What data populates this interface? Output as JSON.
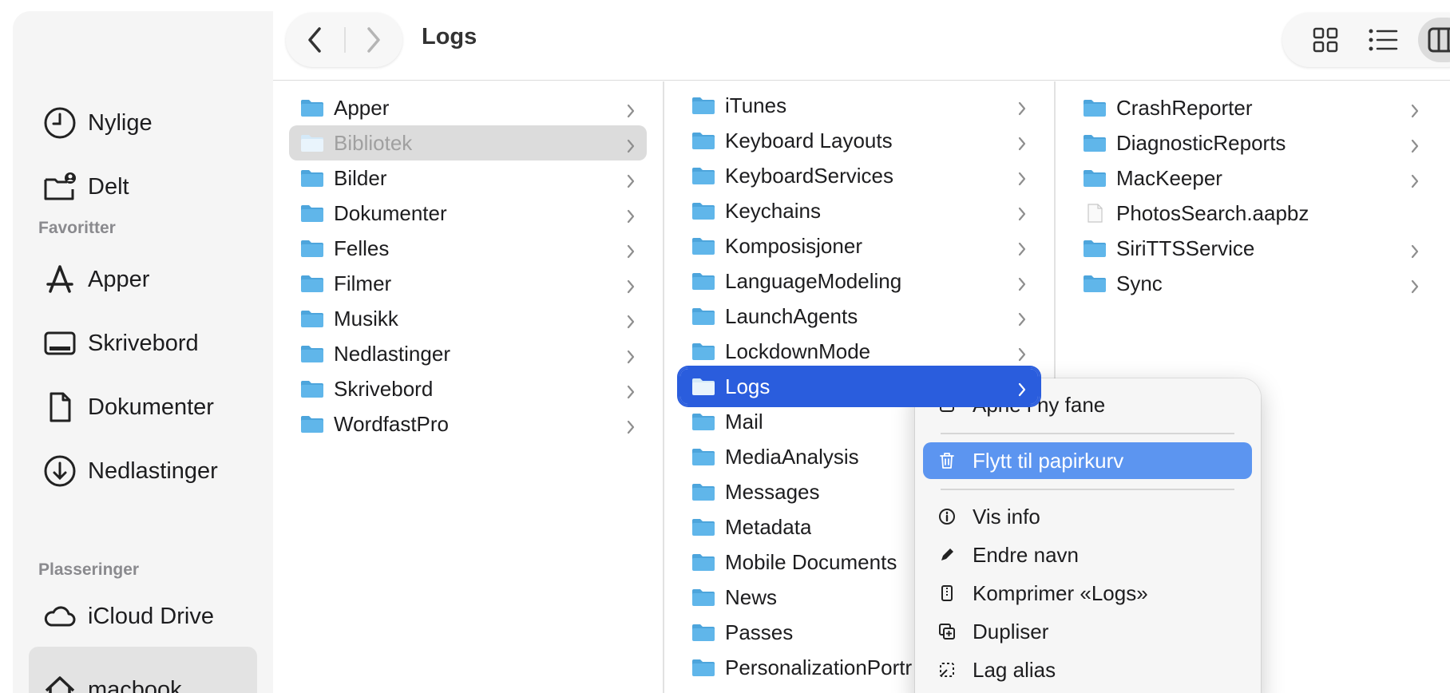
{
  "window": {
    "title": "Logs"
  },
  "sidebar": {
    "top_items": [
      {
        "label": "Nylige",
        "icon": "clock-icon"
      },
      {
        "label": "Delt",
        "icon": "shared-folder-icon"
      }
    ],
    "favorites_heading": "Favoritter",
    "favorites": [
      {
        "label": "Apper",
        "icon": "apps-icon"
      },
      {
        "label": "Skrivebord",
        "icon": "desktop-icon"
      },
      {
        "label": "Dokumenter",
        "icon": "document-icon"
      },
      {
        "label": "Nedlastinger",
        "icon": "download-icon"
      }
    ],
    "locations_heading": "Plasseringer",
    "locations": [
      {
        "label": "iCloud Drive",
        "icon": "cloud-icon"
      },
      {
        "label": "macbook",
        "icon": "home-icon"
      }
    ]
  },
  "columns": {
    "home": [
      "Apper",
      "Bibliotek",
      "Bilder",
      "Dokumenter",
      "Felles",
      "Filmer",
      "Musikk",
      "Nedlastinger",
      "Skrivebord",
      "WordfastPro"
    ],
    "library": [
      "iTunes",
      "Keyboard Layouts",
      "KeyboardServices",
      "Keychains",
      "Komposisjoner",
      "LanguageModeling",
      "LaunchAgents",
      "LockdownMode",
      "Logs",
      "Mail",
      "MediaAnalysis",
      "Messages",
      "Metadata",
      "Mobile Documents",
      "News",
      "Passes",
      "PersonalizationPortr"
    ],
    "logs": [
      "CrashReporter",
      "DiagnosticReports",
      "MacKeeper",
      "PhotosSearch.aapbz",
      "SiriTTSService",
      "Sync"
    ]
  },
  "context_menu": {
    "items": [
      {
        "label": "Åpne i ny fane",
        "icon": "open-tab-icon"
      },
      {
        "label": "Flytt til papirkurv",
        "icon": "trash-icon"
      },
      {
        "label": "Vis info",
        "icon": "info-icon"
      },
      {
        "label": "Endre navn",
        "icon": "pencil-icon"
      },
      {
        "label": "Komprimer «Logs»",
        "icon": "archive-icon"
      },
      {
        "label": "Dupliser",
        "icon": "duplicate-icon"
      },
      {
        "label": "Lag alias",
        "icon": "alias-icon"
      }
    ]
  },
  "colors": {
    "selection": "#2a5ddd",
    "menu_highlight": "#5c95f0",
    "folder": "#5eb6ea"
  }
}
